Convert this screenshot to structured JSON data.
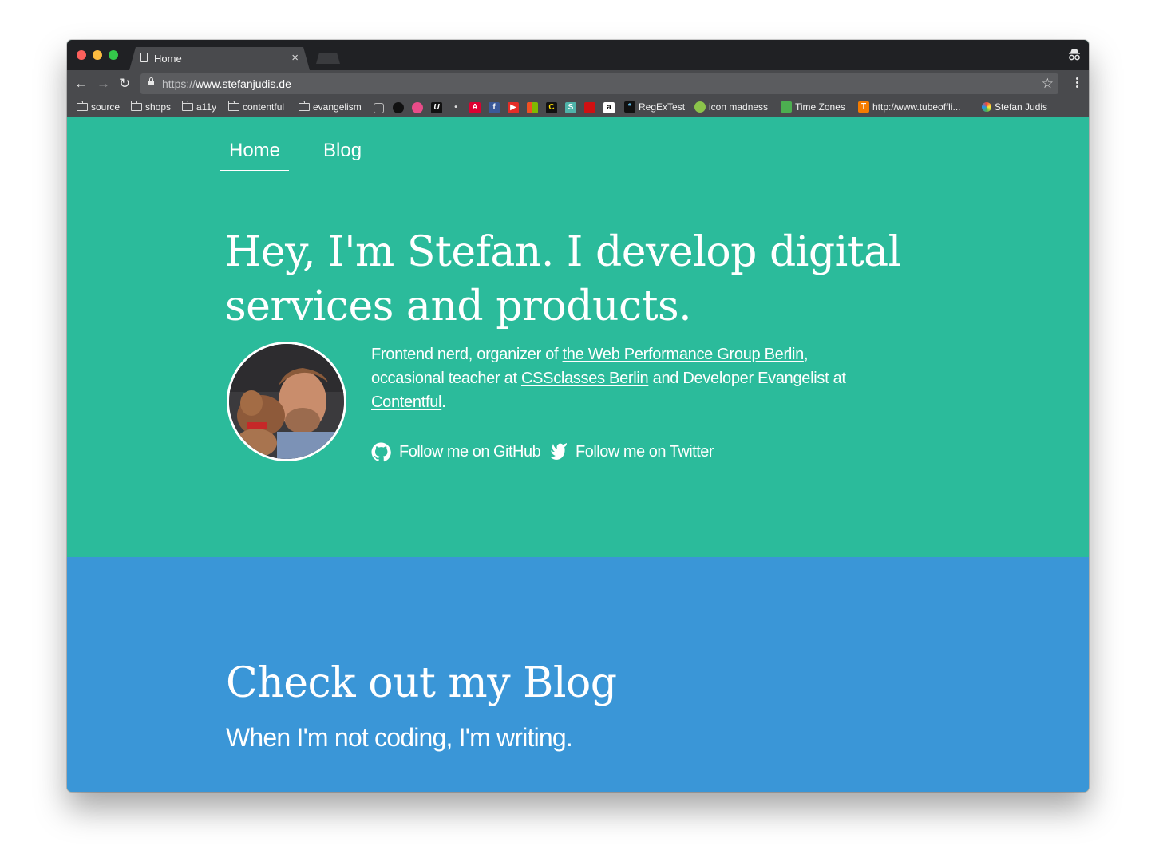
{
  "browser": {
    "tab": {
      "title": "Home",
      "close": "×"
    },
    "url": {
      "scheme": "https://",
      "host": "www.stefanjudis.de"
    },
    "bookmarks": {
      "folders": [
        "source",
        "shops",
        "a11y",
        "contentful",
        "evangelism"
      ],
      "links": [
        "RegExTest",
        "icon madness",
        "Time Zones",
        "http://www.tubeoffli...",
        "Stefan Judis"
      ],
      "favicon_icons": [
        "codepen-icon",
        "github-icon",
        "dribbble-icon",
        "u-icon",
        "owl-icon",
        "angular-icon",
        "facebook-icon",
        "youtube-icon",
        "microsoft-icon",
        "c-icon",
        "s-icon",
        "lego-icon",
        "amazon-icon"
      ]
    }
  },
  "site": {
    "nav": {
      "home": "Home",
      "blog": "Blog"
    },
    "hero": {
      "headline": "Hey, I'm Stefan. I develop digital services and products.",
      "bio": {
        "part1": "Frontend nerd, organizer of ",
        "link1": "the Web Performance Group Berlin",
        "part2": ", occasional teacher at ",
        "link2": "CSSclasses Berlin",
        "part3": " and Developer Evangelist at ",
        "link3": "Contentful",
        "part4": "."
      },
      "social": {
        "github": "Follow me on GitHub",
        "twitter": "Follow me on Twitter"
      }
    },
    "blog": {
      "title": "Check out my Blog",
      "subtitle": "When I'm not coding, I'm writing."
    }
  },
  "colors": {
    "hero_bg": "#2bbb9b",
    "blog_bg": "#3a96d7",
    "browser_frame": "#494a4d"
  }
}
